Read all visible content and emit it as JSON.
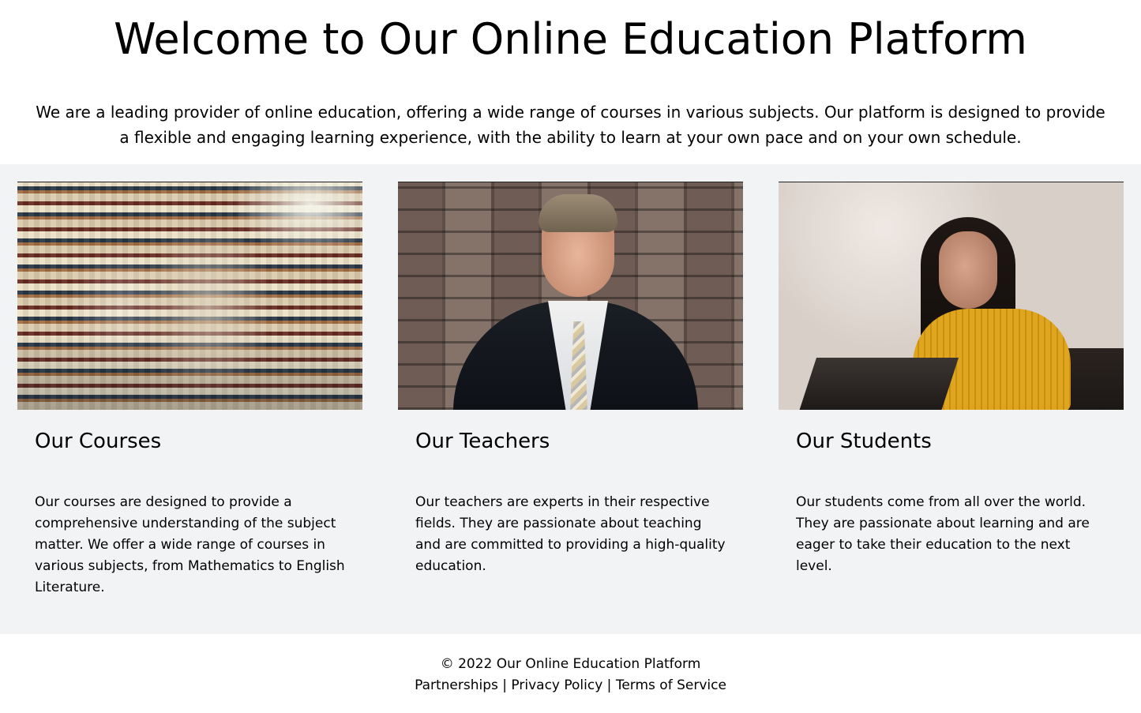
{
  "header": {
    "title": "Welcome to Our Online Education Platform",
    "description": "We are a leading provider of online education, offering a wide range of courses in various subjects. Our platform is designed to provide a flexible and engaging learning experience, with the ability to learn at your own pace and on your own schedule."
  },
  "cards": [
    {
      "title": "Our Courses",
      "text": "Our courses are designed to provide a comprehensive understanding of the subject matter. We offer a wide range of courses in various subjects, from Mathematics to English Literature.",
      "image": "books-stacks-image"
    },
    {
      "title": "Our Teachers",
      "text": "Our teachers are experts in their respective fields. They are passionate about teaching and are committed to providing a high-quality education.",
      "image": "teacher-portrait-image"
    },
    {
      "title": "Our Students",
      "text": "Our students come from all over the world. They are passionate about learning and are eager to take their education to the next level.",
      "image": "student-with-laptop-image"
    }
  ],
  "footer": {
    "copyright": "© 2022 Our Online Education Platform",
    "links": [
      "Partnerships",
      "Privacy Policy",
      "Terms of Service"
    ],
    "separator": " | "
  },
  "colors": {
    "section_background": "#f2f3f5",
    "page_background": "#ffffff",
    "text": "#000000"
  }
}
